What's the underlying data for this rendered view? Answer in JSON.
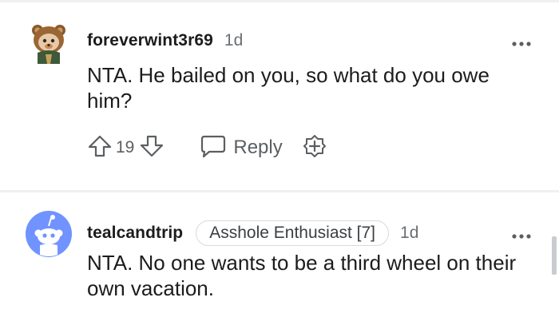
{
  "comments": [
    {
      "username": "foreverwint3r69",
      "age": "1d",
      "flair": "",
      "text": "NTA. He bailed on you, so what do you owe him?",
      "votes": "19",
      "reply_label": "Reply",
      "avatar": "snoo-avatar-bear-costume"
    },
    {
      "username": "tealcandtrip",
      "age": "1d",
      "flair": "Asshole Enthusiast [7]",
      "text": "NTA. No one wants to be a third wheel on their own vacation.",
      "avatar": "default-snoo-avatar-blue"
    }
  ],
  "colors": {
    "divider": "#eef0f1",
    "meta_text": "#6b6f72",
    "body_text": "#1c1c1c",
    "avatar_blue": "#7193ff"
  }
}
